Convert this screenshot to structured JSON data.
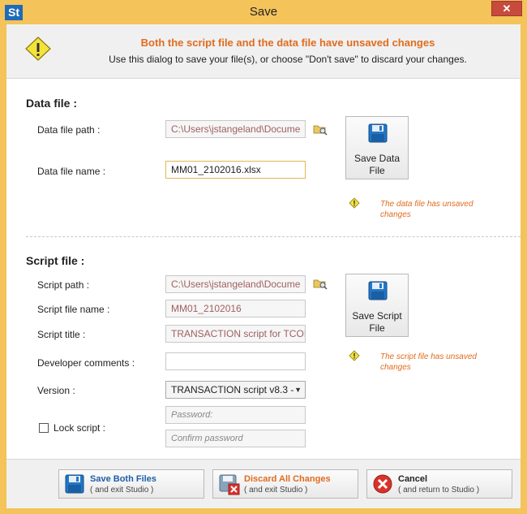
{
  "window": {
    "title": "Save",
    "app_icon_text": "St",
    "close_glyph": "✕"
  },
  "header": {
    "title": "Both the script file and the data file have unsaved changes",
    "subtitle": "Use this dialog to save your file(s), or choose \"Don't save\" to discard your changes."
  },
  "data_file": {
    "section_title": "Data file :",
    "path_label": "Data file path :",
    "path_value": "C:\\Users\\jstangeland\\Docume",
    "name_label": "Data file name :",
    "name_value": "MM01_2102016.xlsx",
    "save_button": "Save Data File",
    "warning": "The data file has unsaved changes"
  },
  "script_file": {
    "section_title": "Script file :",
    "path_label": "Script path :",
    "path_value": "C:\\Users\\jstangeland\\Docume",
    "name_label": "Script file name :",
    "name_value": "MM01_2102016",
    "title_label": "Script title :",
    "title_value": "TRANSACTION script for TCOI",
    "comments_label": "Developer comments :",
    "comments_value": "",
    "version_label": "Version :",
    "version_value": "TRANSACTION script v8.3 -",
    "lock_label": "Lock script :",
    "password_placeholder": "Password:",
    "confirm_placeholder": "Confirm password",
    "save_button": "Save Script File",
    "warning": "The script file has unsaved changes"
  },
  "footer": {
    "save_both": {
      "label": "Save Both Files",
      "sub": "( and exit Studio )"
    },
    "discard": {
      "label": "Discard All Changes",
      "sub": "( and exit Studio )"
    },
    "cancel": {
      "label": "Cancel",
      "sub": "( and return to Studio )"
    }
  },
  "colors": {
    "accent": "#e06c1e",
    "blue": "#1f5ea8",
    "frame": "#f4c35a"
  }
}
